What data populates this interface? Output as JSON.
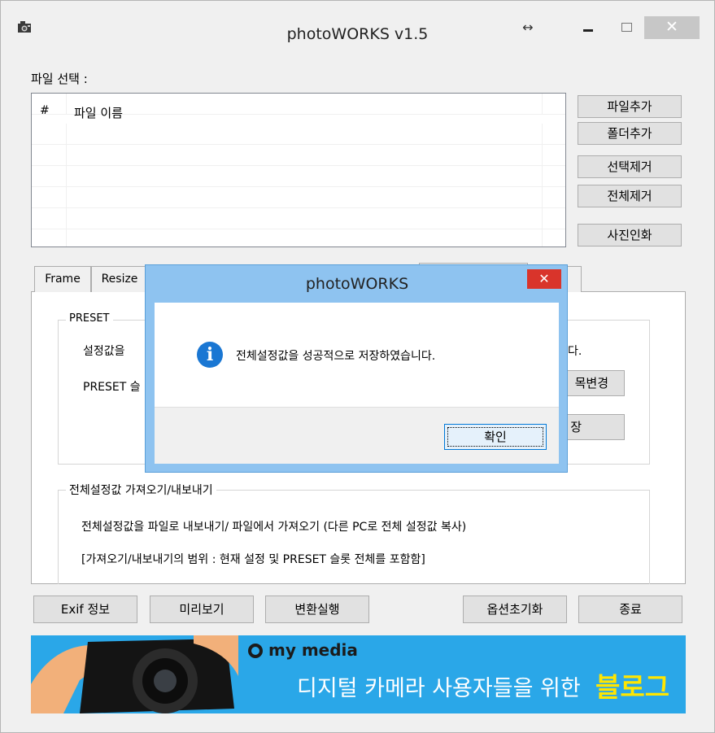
{
  "window": {
    "title": "photoWORKS v1.5",
    "controls": {
      "resize": "↔",
      "close": "✕"
    }
  },
  "file_select": {
    "label": "파일 선택 :",
    "columns": [
      "#",
      "파일 이름"
    ],
    "rows": []
  },
  "side_buttons": {
    "add_file": "파일추가",
    "add_folder": "폴더추가",
    "remove_selected": "선택제거",
    "remove_all": "전체제거",
    "print_photo": "사진인화"
  },
  "tabs": {
    "frame": "Frame",
    "resize": "Resize"
  },
  "preset_group": {
    "title": "PRESET",
    "line1_visible": "설정값을",
    "line1_tail": "다.",
    "line2_visible": "PRESET 슬",
    "btn_rename_visible": "목변경",
    "btn_save_visible": "장"
  },
  "global_group": {
    "title": "전체설정값 가져오기/내보내기",
    "desc1": "전체설정값을 파일로 내보내기/ 파일에서 가져오기 (다른 PC로 전체 설정값 복사)",
    "desc2": "[가져오기/내보내기의 범위 : 현재 설정 및 PRESET 슬롯 전체를 포함함]"
  },
  "bottom_buttons": {
    "exif": "Exif 정보",
    "preview": "미리보기",
    "convert": "변환실행",
    "reset_options": "옵션초기화",
    "exit": "종료"
  },
  "banner": {
    "brand": "my media",
    "text": "디지털 카메라 사용자들을 위한",
    "highlight": "블로그",
    "colors": {
      "background": "#2aa7e8",
      "highlight": "#ffe600"
    }
  },
  "dialog": {
    "title": "photoWORKS",
    "message": "전체설정값을 성공적으로 저장하였습니다.",
    "ok_label": "확인",
    "icon": "info-icon",
    "close": "✕"
  }
}
